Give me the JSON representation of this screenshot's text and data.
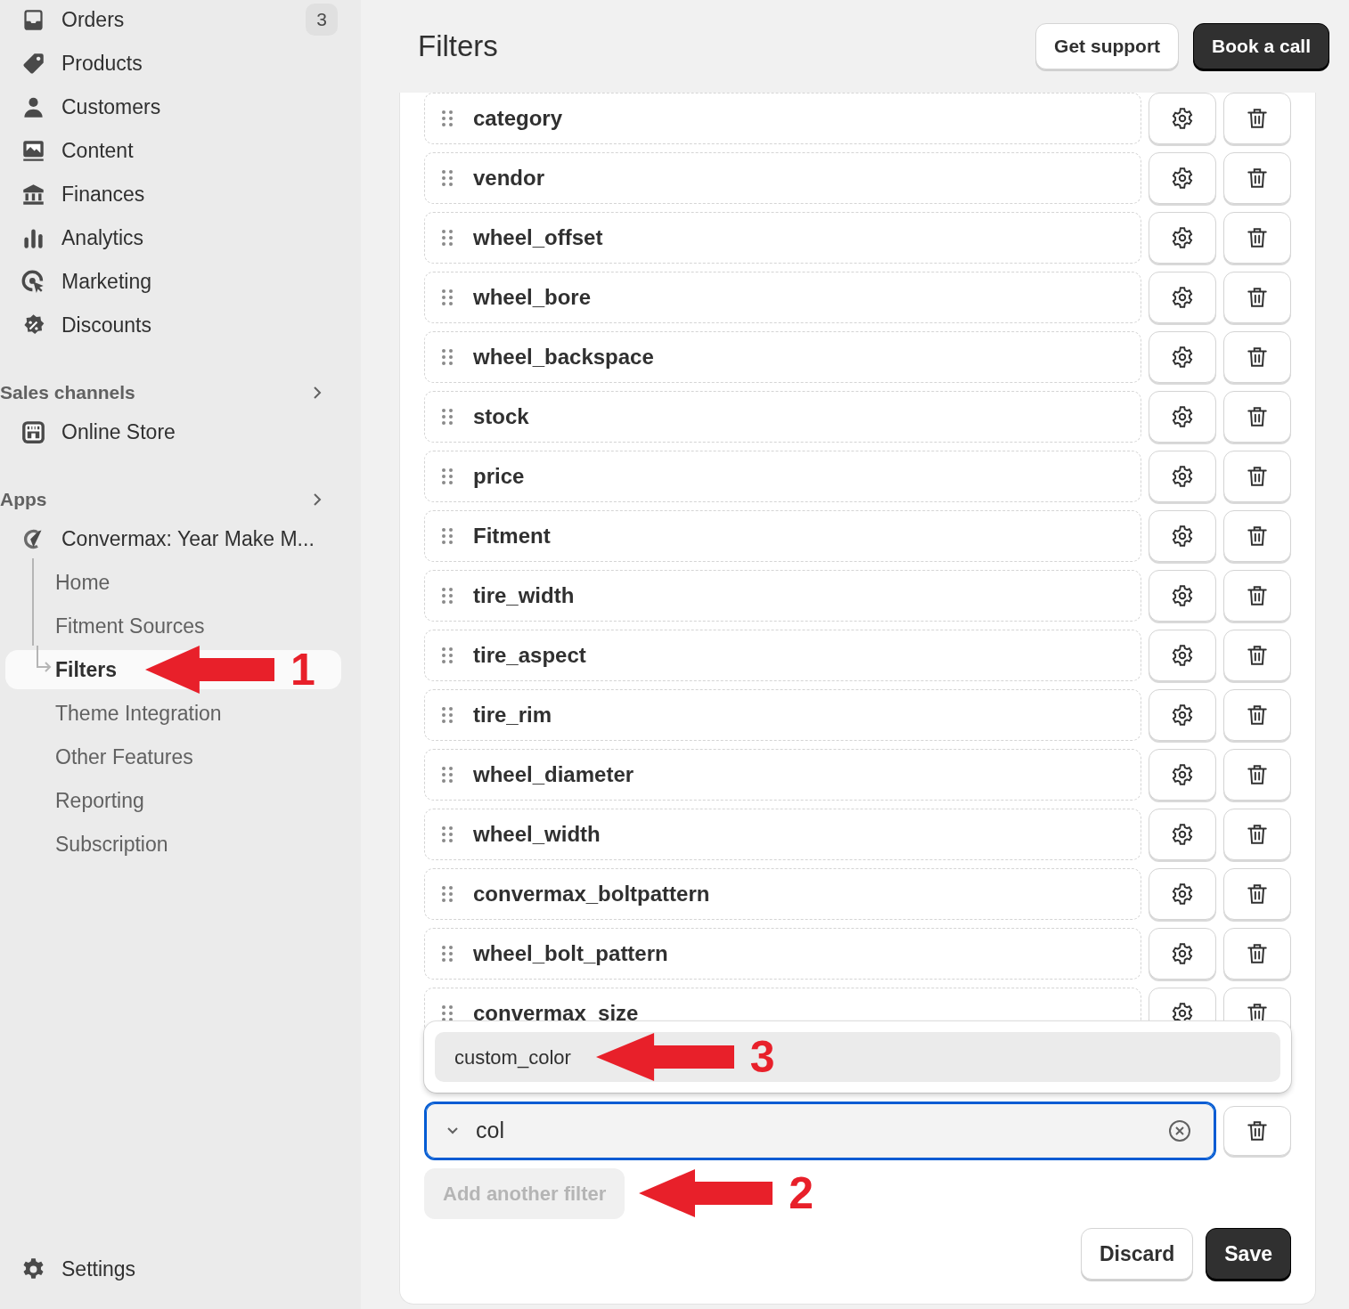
{
  "sidebar": {
    "main_items": [
      {
        "label": "Orders",
        "badge": "3"
      },
      {
        "label": "Products"
      },
      {
        "label": "Customers"
      },
      {
        "label": "Content"
      },
      {
        "label": "Finances"
      },
      {
        "label": "Analytics"
      },
      {
        "label": "Marketing"
      },
      {
        "label": "Discounts"
      }
    ],
    "sales_channels": {
      "title": "Sales channels",
      "items": [
        {
          "label": "Online Store"
        }
      ]
    },
    "apps": {
      "title": "Apps",
      "app": {
        "label": "Convermax: Year Make M...",
        "children": [
          {
            "label": "Home",
            "selected": false
          },
          {
            "label": "Fitment Sources",
            "selected": false
          },
          {
            "label": "Filters",
            "selected": true,
            "annotation": "1"
          },
          {
            "label": "Theme Integration",
            "selected": false
          },
          {
            "label": "Other Features",
            "selected": false
          },
          {
            "label": "Reporting",
            "selected": false
          },
          {
            "label": "Subscription",
            "selected": false
          }
        ]
      }
    },
    "settings": {
      "label": "Settings"
    }
  },
  "header": {
    "title": "Filters",
    "buttons": [
      {
        "label": "Get support",
        "kind": "secondary"
      },
      {
        "label": "Book a call",
        "kind": "primary"
      }
    ]
  },
  "filters": [
    {
      "name": "category"
    },
    {
      "name": "vendor"
    },
    {
      "name": "wheel_offset"
    },
    {
      "name": "wheel_bore"
    },
    {
      "name": "wheel_backspace"
    },
    {
      "name": "stock"
    },
    {
      "name": "price"
    },
    {
      "name": "Fitment"
    },
    {
      "name": "tire_width"
    },
    {
      "name": "tire_aspect"
    },
    {
      "name": "tire_rim"
    },
    {
      "name": "wheel_diameter"
    },
    {
      "name": "wheel_width"
    },
    {
      "name": "convermax_boltpattern"
    },
    {
      "name": "wheel_bolt_pattern"
    },
    {
      "name": "convermax_size"
    }
  ],
  "new_filter": {
    "value": "col",
    "suggestions": [
      {
        "label": "custom_color",
        "selected": true,
        "annotation": "3"
      }
    ]
  },
  "add_button": {
    "label": "Add another filter",
    "disabled": true,
    "annotation": "2"
  },
  "footer_buttons": [
    {
      "label": "Discard",
      "kind": "secondary"
    },
    {
      "label": "Save",
      "kind": "primary"
    }
  ]
}
